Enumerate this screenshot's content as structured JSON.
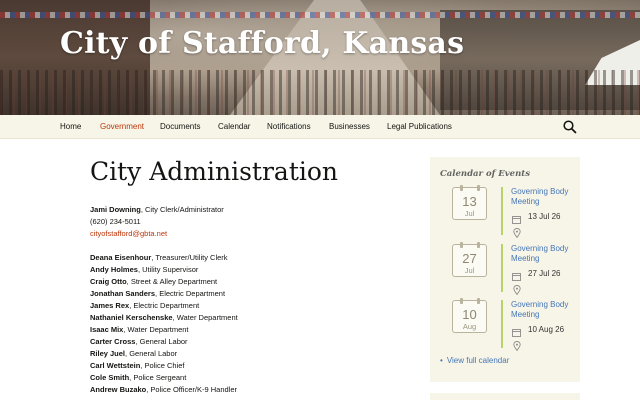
{
  "site": {
    "title": "City of Stafford, Kansas"
  },
  "nav": {
    "items": [
      {
        "label": "Home"
      },
      {
        "label": "Government"
      },
      {
        "label": "Documents"
      },
      {
        "label": "Calendar"
      },
      {
        "label": "Notifications"
      },
      {
        "label": "Businesses"
      },
      {
        "label": "Legal Publications"
      }
    ],
    "active_index": 1,
    "search_icon": "search-icon"
  },
  "main": {
    "title": "City Administration",
    "contact": {
      "name": "Jami Downing",
      "role": ", City Clerk/Administrator",
      "phone": "(620) 234-5011",
      "email": "cityofstafford@gbta.net"
    },
    "staff": [
      {
        "name": "Deana Eisenhour",
        "role": ", Treasurer/Utility Clerk"
      },
      {
        "name": "Andy Holmes",
        "role": ", Utility Supervisor"
      },
      {
        "name": "Craig Otto",
        "role": ", Street & Alley Department"
      },
      {
        "name": "Jonathan Sanders",
        "role": ", Electric Department"
      },
      {
        "name": "James Rex",
        "role": ", Electric Department"
      },
      {
        "name": "Nathaniel Kerschenske",
        "role": ", Water Department"
      },
      {
        "name": "Isaac Mix",
        "role": ", Water Department"
      },
      {
        "name": "Carter Cross",
        "role": ", General Labor"
      },
      {
        "name": "Riley Juel",
        "role": ", General Labor"
      },
      {
        "name": "Carl Wettstein",
        "role": ", Police Chief"
      },
      {
        "name": "Cole Smith",
        "role": ", Police Sergeant"
      },
      {
        "name": "Andrew Buzako",
        "role": ", Police Officer/K-9 Handler"
      }
    ]
  },
  "sidebar": {
    "widget_title": "Calendar of Events",
    "events": [
      {
        "day": "13",
        "month": "Jul",
        "title": "Governing Body Meeting",
        "date": "13 Jul 26"
      },
      {
        "day": "27",
        "month": "Jul",
        "title": "Governing Body Meeting",
        "date": "27 Jul 26"
      },
      {
        "day": "10",
        "month": "Aug",
        "title": "Governing Body Meeting",
        "date": "10 Aug 26"
      }
    ],
    "full_calendar_link": "View full calendar"
  },
  "colors": {
    "accent": "#bc360a",
    "nav_bg": "#f7f5e7",
    "link": "#4576b8",
    "event_bar": "#b8d36a"
  }
}
